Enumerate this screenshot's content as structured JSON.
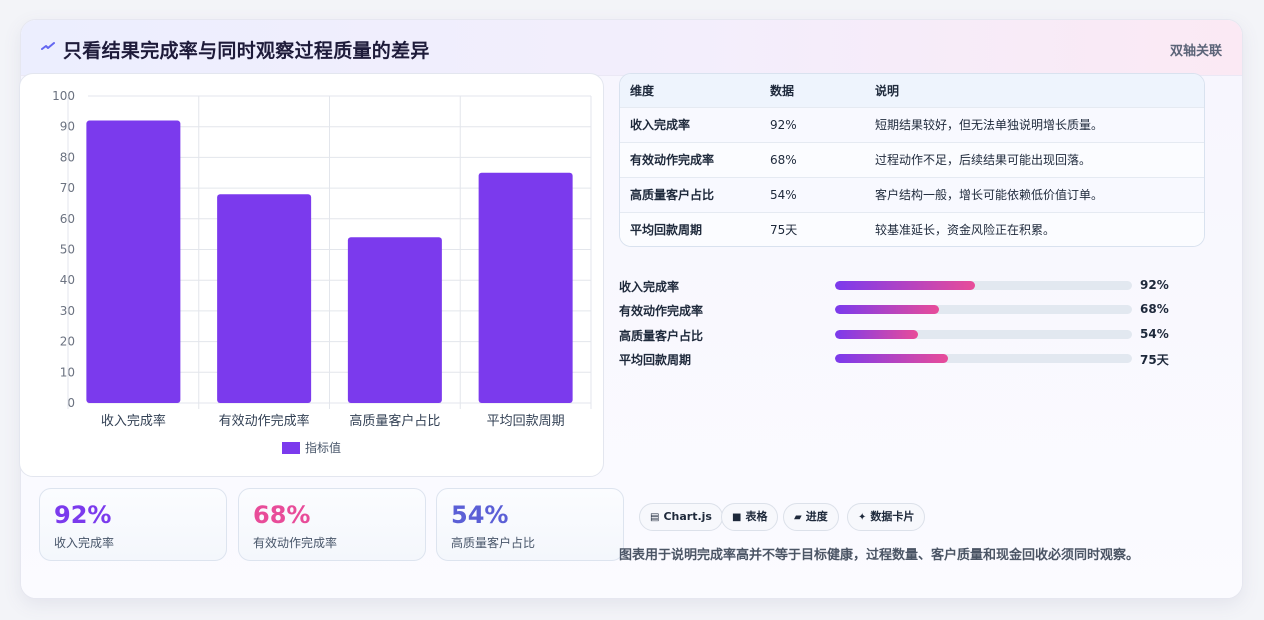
{
  "header": {
    "title": "只看结果完成率与同时观察过程质量的差异",
    "badge": "双轴关联",
    "icon": "spark-icon"
  },
  "chart_data": {
    "type": "bar",
    "categories": [
      "收入完成率",
      "有效动作完成率",
      "高质量客户占比",
      "平均回款周期"
    ],
    "series": [
      {
        "name": "指标值",
        "values": [
          92,
          68,
          54,
          75
        ],
        "color": "#7b3aed"
      }
    ],
    "ylim": [
      0,
      100
    ],
    "yticks": [
      "0",
      "10",
      "20",
      "30",
      "40",
      "50",
      "60",
      "70",
      "80",
      "90",
      "100"
    ],
    "grid": true,
    "legend": "bottom"
  },
  "kpis": [
    {
      "value": "92%",
      "label": "收入完成率",
      "color": "#7b3aed"
    },
    {
      "value": "68%",
      "label": "有效动作完成率",
      "color": "#e84c99"
    },
    {
      "value": "54%",
      "label": "高质量客户占比",
      "color": "#5b5fd6"
    }
  ],
  "table": {
    "headers": [
      "维度",
      "数据",
      "说明"
    ],
    "rows": [
      [
        "收入完成率",
        "92%",
        "短期结果较好，但无法单独说明增长质量。"
      ],
      [
        "有效动作完成率",
        "68%",
        "过程动作不足，后续结果可能出现回落。"
      ],
      [
        "高质量客户占比",
        "54%",
        "客户结构一般，增长可能依赖低价值订单。"
      ],
      [
        "平均回款周期",
        "75天",
        "较基准延长，资金风险正在积累。"
      ]
    ]
  },
  "progress": [
    {
      "label": "收入完成率",
      "value_text": "92%",
      "fraction": 0.47
    },
    {
      "label": "有效动作完成率",
      "value_text": "68%",
      "fraction": 0.35
    },
    {
      "label": "高质量客户占比",
      "value_text": "54%",
      "fraction": 0.28
    },
    {
      "label": "平均回款周期",
      "value_text": "75天",
      "fraction": 0.38
    }
  ],
  "tags": [
    {
      "icon": "chart-icon",
      "glyph": "▤",
      "label": "Chart.js"
    },
    {
      "icon": "table-icon",
      "glyph": "■",
      "label": "表格"
    },
    {
      "icon": "progress-icon",
      "glyph": "▰",
      "label": "进度"
    },
    {
      "icon": "sparkle-icon",
      "glyph": "✦",
      "label": "数据卡片"
    }
  ],
  "note": "图表用于说明完成率高并不等于目标健康，过程数量、客户质量和现金回收必须同时观察。"
}
